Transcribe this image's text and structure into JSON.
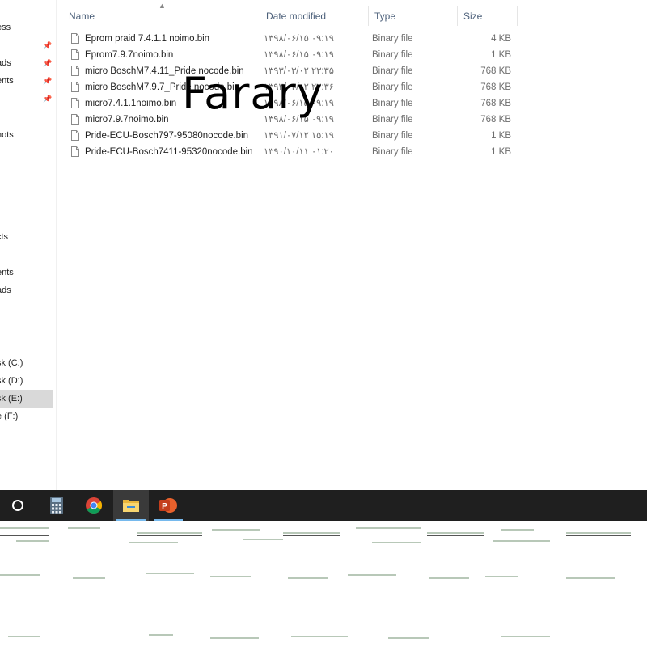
{
  "sidebar": {
    "items": [
      {
        "label": "ess",
        "pinned": false
      },
      {
        "label": "",
        "pinned": true
      },
      {
        "label": "ads",
        "pinned": true
      },
      {
        "label": "ents",
        "pinned": true
      },
      {
        "label": "",
        "pinned": true
      },
      {
        "label": "hots",
        "pinned": false
      },
      {
        "label": "cts",
        "pinned": false
      },
      {
        "label": "ents",
        "pinned": false
      },
      {
        "label": "ads",
        "pinned": false
      },
      {
        "label": "sk (C:)",
        "pinned": false
      },
      {
        "label": "sk (D:)",
        "pinned": false
      },
      {
        "label": "sk (E:)",
        "pinned": false
      },
      {
        "label": "e (F:)",
        "pinned": false
      }
    ]
  },
  "columns": {
    "name": "Name",
    "date": "Date modified",
    "type": "Type",
    "size": "Size"
  },
  "files": [
    {
      "name": "Eprom praid 7.4.1.1 noimo.bin",
      "date": "۱۳۹۸/۰۶/۱۵ ۰۹:۱۹",
      "type": "Binary file",
      "size": "4 KB"
    },
    {
      "name": "Eprom7.9.7noimo.bin",
      "date": "۱۳۹۸/۰۶/۱۵ ۰۹:۱۹",
      "type": "Binary file",
      "size": "1 KB"
    },
    {
      "name": "micro BoschM7.4.11_Pride nocode.bin",
      "date": "۱۳۹۳/۰۳/۰۲ ۲۳:۳۵",
      "type": "Binary file",
      "size": "768 KB"
    },
    {
      "name": "micro BoschM7.9.7_Pride nocode.bin",
      "date": "۱۳۹۳/۰۳/۰۲ ۲۳:۳۶",
      "type": "Binary file",
      "size": "768 KB"
    },
    {
      "name": "micro7.4.1.1noimo.bin",
      "date": "۱۳۹۸/۰۶/۱۵ ۰۹:۱۹",
      "type": "Binary file",
      "size": "768 KB"
    },
    {
      "name": "micro7.9.7noimo.bin",
      "date": "۱۳۹۸/۰۶/۱۵ ۰۹:۱۹",
      "type": "Binary file",
      "size": "768 KB"
    },
    {
      "name": "Pride-ECU-Bosch797-95080nocode.bin",
      "date": "۱۳۹۱/۰۷/۱۲ ۱۵:۱۹",
      "type": "Binary file",
      "size": "1 KB"
    },
    {
      "name": "Pride-ECU-Bosch7411-95320nocode.bin",
      "date": "۱۳۹۰/۱۰/۱۱ ۰۱:۲۰",
      "type": "Binary file",
      "size": "1 KB"
    }
  ],
  "watermark": "Farary",
  "taskbar": {
    "icons": [
      "cortana-circle-icon",
      "calculator-icon",
      "chrome-icon",
      "file-explorer-icon",
      "powerpoint-icon"
    ],
    "accent": "#76b9ed"
  },
  "colors": {
    "selected_bg": "#d9d9d9",
    "taskbar_bg": "#1f1f1f",
    "header_text": "#4c607a"
  }
}
